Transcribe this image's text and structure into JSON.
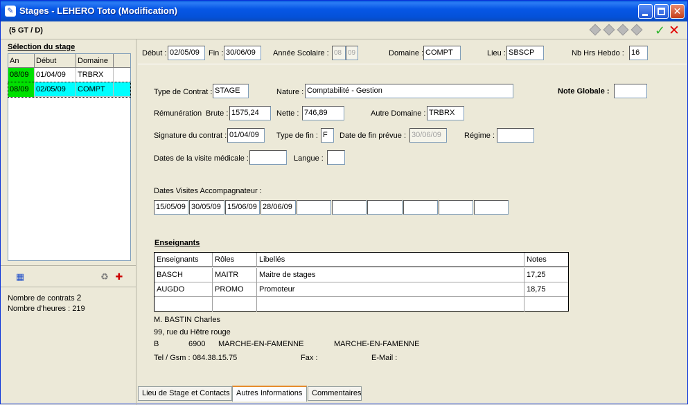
{
  "window": {
    "title": "Stages - LEHERO Toto (Modification)"
  },
  "header": {
    "class_label": "(5 GT / D)"
  },
  "sidebar": {
    "title": "Sélection du stage",
    "columns": [
      "An",
      "Début",
      "Domaine"
    ],
    "rows": [
      {
        "an": "08/09",
        "debut": "01/04/09",
        "domaine": "TRBRX",
        "selected": false
      },
      {
        "an": "08/09",
        "debut": "02/05/09",
        "domaine": "COMPT",
        "selected": true
      }
    ],
    "nb_contrats_label": "Nombre de contrats",
    "nb_contrats": "2",
    "nb_heures_label": "Nombre d'heures :",
    "nb_heures": "219"
  },
  "top_fields": {
    "debut_label": "Début :",
    "debut": "02/05/09",
    "fin_label": "Fin :",
    "fin": "30/06/09",
    "annee_label": "Année Scolaire :",
    "annee_1": "08",
    "annee_2": "09",
    "domaine_label": "Domaine :",
    "domaine": "COMPT",
    "lieu_label": "Lieu :",
    "lieu": "SBSCP",
    "nbhrs_label": "Nb Hrs Hebdo :",
    "nbhrs": "16"
  },
  "form": {
    "type_contrat_label": "Type de Contrat :",
    "type_contrat": "STAGE",
    "nature_label": "Nature :",
    "nature": "Comptabilité - Gestion",
    "note_globale_label": "Note Globale :",
    "note_globale": "",
    "remuneration_label": "Rémunération",
    "brute_label": "Brute :",
    "brute": "1575,24",
    "nette_label": "Nette :",
    "nette": "746,89",
    "autre_domaine_label": "Autre Domaine :",
    "autre_domaine": "TRBRX",
    "signature_label": "Signature du contrat :",
    "signature": "01/04/09",
    "type_fin_label": "Type de fin :",
    "type_fin": "F",
    "date_fin_prevue_label": "Date de fin prévue :",
    "date_fin_prevue": "30/06/09",
    "regime_label": "Régime :",
    "regime": "",
    "visite_medicale_label": "Dates de la visite médicale :",
    "visite_medicale": "",
    "langue_label": "Langue :",
    "langue": "",
    "visites_label": "Dates Visites Accompagnateur :",
    "visites": [
      "15/05/09",
      "30/05/09",
      "15/06/09",
      "28/06/09",
      "",
      "",
      "",
      "",
      "",
      ""
    ]
  },
  "enseignants": {
    "title": "Enseignants",
    "columns": [
      "Enseignants",
      "Rôles",
      "Libellés",
      "Notes"
    ],
    "rows": [
      {
        "ens": "BASCH",
        "role": "MAITR",
        "libelle": "Maitre de stages",
        "note": "17,25"
      },
      {
        "ens": "AUGDO",
        "role": "PROMO",
        "libelle": "Promoteur",
        "note": "18,75"
      }
    ]
  },
  "contact": {
    "name": "M. BASTIN Charles",
    "address": "99, rue du Hêtre rouge",
    "country": "B",
    "postcode": "6900",
    "city1": "MARCHE-EN-FAMENNE",
    "city2": "MARCHE-EN-FAMENNE",
    "tel_label": "Tel / Gsm :",
    "tel": "084.38.15.75",
    "fax_label": "Fax :",
    "email_label": "E-Mail :"
  },
  "tabs": [
    "Lieu de Stage et Contacts",
    "Autres Informations",
    "Commentaires"
  ],
  "colors": {
    "selected_row": "#00ffff",
    "an_cell": "#00e000",
    "title_bar": "#0757e6"
  }
}
